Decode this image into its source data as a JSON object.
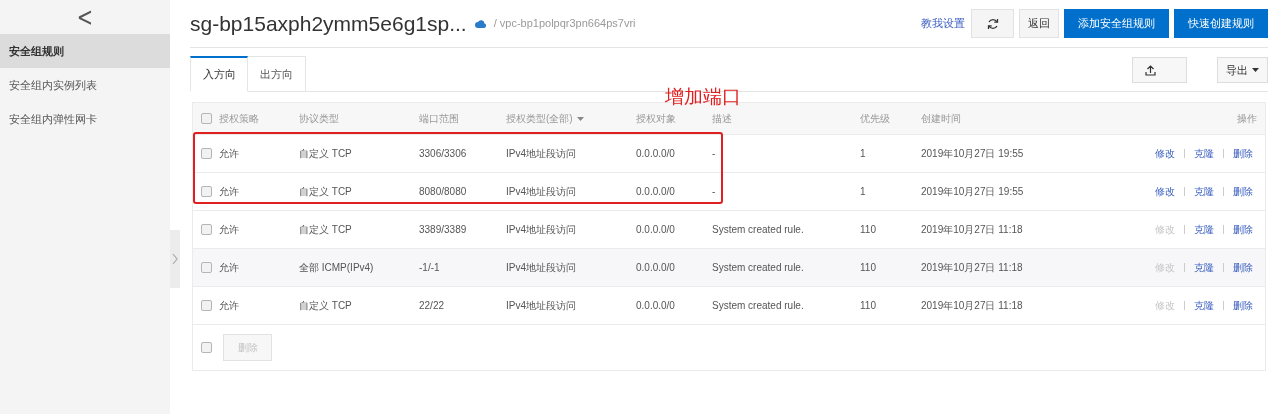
{
  "sidebar": {
    "back": "<",
    "items": [
      {
        "label": "安全组规则",
        "selected": true
      },
      {
        "label": "安全组内实例列表",
        "selected": false
      },
      {
        "label": "安全组内弹性网卡",
        "selected": false
      }
    ]
  },
  "header": {
    "title": "sg-bp15axph2ymm5e6g1sp...",
    "vpc": "/ vpc-bp1polpqr3pn664ps7vri",
    "help_link": "教我设置",
    "buttons": [
      {
        "kind": "refresh"
      },
      {
        "kind": "plain",
        "label": "返回"
      },
      {
        "kind": "primary",
        "label": "添加安全组规则"
      },
      {
        "kind": "primary",
        "label": "快速创建规则"
      }
    ]
  },
  "tabs": [
    {
      "label": "入方向",
      "selected": true
    },
    {
      "label": "出方向",
      "selected": false
    }
  ],
  "toolbar": {
    "export_label": "导出"
  },
  "annotation": {
    "label": "增加端口",
    "color": "#e02020"
  },
  "table": {
    "select_all_checked": false,
    "columns": [
      "授权策略",
      "协议类型",
      "端口范围",
      "授权类型(全部)",
      "授权对象",
      "描述",
      "优先级",
      "创建时间",
      "操作"
    ],
    "rows": [
      {
        "checked": false,
        "highlighted": false,
        "cells": [
          "允许",
          "自定义 TCP",
          "3306/3306",
          "IPv4地址段访问",
          "0.0.0.0/0",
          "-",
          "1",
          "2019年10月27日 19:55"
        ],
        "actions": [
          {
            "label": "修改",
            "disabled": false
          },
          {
            "label": "克隆",
            "disabled": false
          },
          {
            "label": "删除",
            "disabled": false
          }
        ]
      },
      {
        "checked": false,
        "highlighted": false,
        "cells": [
          "允许",
          "自定义 TCP",
          "8080/8080",
          "IPv4地址段访问",
          "0.0.0.0/0",
          "-",
          "1",
          "2019年10月27日 19:55"
        ],
        "actions": [
          {
            "label": "修改",
            "disabled": false
          },
          {
            "label": "克隆",
            "disabled": false
          },
          {
            "label": "删除",
            "disabled": false
          }
        ]
      },
      {
        "checked": false,
        "highlighted": false,
        "cells": [
          "允许",
          "自定义 TCP",
          "3389/3389",
          "IPv4地址段访问",
          "0.0.0.0/0",
          "System created rule.",
          "110",
          "2019年10月27日 11:18"
        ],
        "actions": [
          {
            "label": "修改",
            "disabled": true
          },
          {
            "label": "克隆",
            "disabled": false
          },
          {
            "label": "删除",
            "disabled": false
          }
        ]
      },
      {
        "checked": false,
        "highlighted": true,
        "cells": [
          "允许",
          "全部 ICMP(IPv4)",
          "-1/-1",
          "IPv4地址段访问",
          "0.0.0.0/0",
          "System created rule.",
          "110",
          "2019年10月27日 11:18"
        ],
        "actions": [
          {
            "label": "修改",
            "disabled": true
          },
          {
            "label": "克隆",
            "disabled": false
          },
          {
            "label": "删除",
            "disabled": false
          }
        ]
      },
      {
        "checked": false,
        "highlighted": false,
        "cells": [
          "允许",
          "自定义 TCP",
          "22/22",
          "IPv4地址段访问",
          "0.0.0.0/0",
          "System created rule.",
          "110",
          "2019年10月27日 11:18"
        ],
        "actions": [
          {
            "label": "修改",
            "disabled": true
          },
          {
            "label": "克隆",
            "disabled": false
          },
          {
            "label": "删除",
            "disabled": false
          }
        ]
      }
    ],
    "footer": {
      "checked": false,
      "delete_label": "删除",
      "delete_disabled": true
    }
  }
}
